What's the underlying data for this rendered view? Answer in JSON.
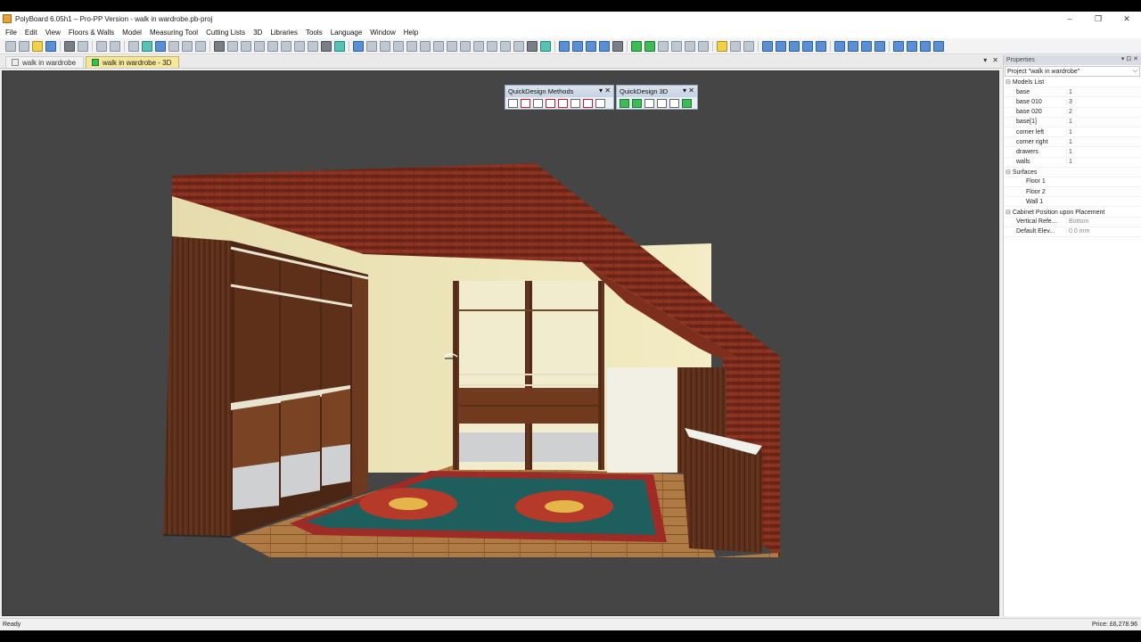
{
  "window": {
    "title": "PolyBoard 6.05h1 – Pro-PP Version - walk in wardrobe.pb-proj",
    "controls": [
      "–",
      "❐",
      "✕"
    ]
  },
  "menu": [
    "File",
    "Edit",
    "View",
    "Floors & Walls",
    "Model",
    "Measuring Tool",
    "Cutting Lists",
    "3D",
    "Libraries",
    "Tools",
    "Language",
    "Window",
    "Help"
  ],
  "tabs": [
    {
      "label": "walk in wardrobe",
      "active": false
    },
    {
      "label": "walk in wardrobe - 3D",
      "active": true
    }
  ],
  "tab_controls": {
    "dropdown": "▾",
    "close": "✕"
  },
  "quickdesign_methods": {
    "title": "QuickDesign Methods",
    "controls": "▾ ✕"
  },
  "quickdesign_3d": {
    "title": "QuickDesign 3D",
    "controls": "▾ ✕"
  },
  "properties": {
    "header": "Properties",
    "header_controls": "▾ ⊡ ✕",
    "selector": "Project \"walk in wardrobe\"",
    "models_list": {
      "label": "Models List",
      "items": [
        {
          "name": "base",
          "value": "1"
        },
        {
          "name": "base 010",
          "value": "3"
        },
        {
          "name": "base 020",
          "value": "2"
        },
        {
          "name": "base[1]",
          "value": "1"
        },
        {
          "name": "corner left",
          "value": "1"
        },
        {
          "name": "corner right",
          "value": "1"
        },
        {
          "name": "drawers",
          "value": "1"
        },
        {
          "name": "walls",
          "value": "1"
        }
      ]
    },
    "surfaces": {
      "label": "Surfaces",
      "items": [
        "Floor 1",
        "Floor 2",
        "Wall 1"
      ]
    },
    "cabinet_position": {
      "label": "Cabinet Position upon Placement",
      "items": [
        {
          "name": "Vertical Refe...",
          "value": "Bottom"
        },
        {
          "name": "Default Elev...",
          "value": "0.0 mm"
        }
      ]
    }
  },
  "status": {
    "left": "Ready",
    "price": "Price: £6,278.96"
  }
}
